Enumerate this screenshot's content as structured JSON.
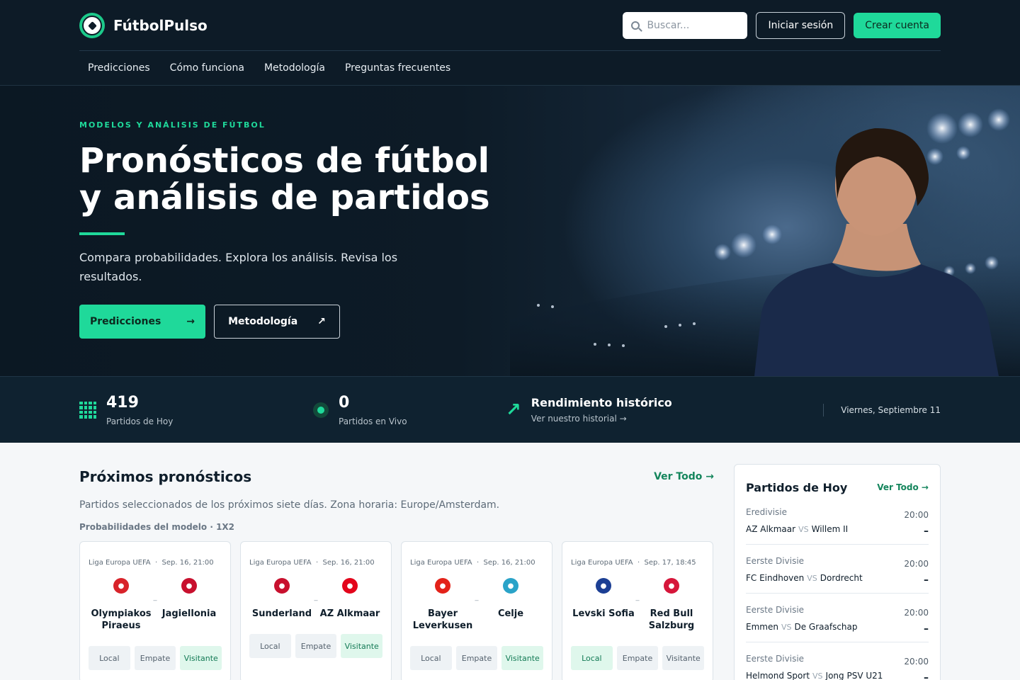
{
  "header": {
    "brand": "FútbolPulso",
    "search_placeholder": "Buscar...",
    "login": "Iniciar sesión",
    "signup": "Crear cuenta",
    "nav": [
      "Predicciones",
      "Cómo funciona",
      "Metodología",
      "Preguntas frecuentes"
    ]
  },
  "hero": {
    "eyebrow": "MODELOS Y ANÁLISIS DE FÚTBOL",
    "title_line1": "Pronósticos de fútbol",
    "title_line2": "y análisis de partidos",
    "subtitle": "Compara probabilidades. Explora los análisis. Revisa los resultados.",
    "cta_primary": "Predicciones",
    "cta_primary_icon": "→",
    "cta_secondary": "Metodología",
    "cta_secondary_icon": "↗"
  },
  "stats": {
    "today_count": "419",
    "today_label": "Partidos de Hoy",
    "live_count": "0",
    "live_label": "Partidos en Vivo",
    "perf_title": "Rendimiento histórico",
    "perf_link": "Ver nuestro historial →",
    "date": "Viernes, Septiembre 11"
  },
  "upcoming": {
    "title": "Próximos pronósticos",
    "view_all": "Ver Todo →",
    "description": "Partidos seleccionados de los próximos siete días. Zona horaria: Europe/Amsterdam.",
    "prob_label": "Probabilidades del modelo · 1X2",
    "option_labels": [
      "Local",
      "Empate",
      "Visitante"
    ],
    "cards": [
      {
        "competition": "Liga Europa UEFA",
        "date": "Sep. 16, 21:00",
        "home": "Olympiakos Piraeus",
        "away": "Jagiellonia",
        "home_color": "#d8232a",
        "away_color": "#c8102e",
        "highlight": 2
      },
      {
        "competition": "Liga Europa UEFA",
        "date": "Sep. 16, 21:00",
        "home": "Sunderland",
        "away": "AZ Alkmaar",
        "home_color": "#c8102e",
        "away_color": "#e3051b",
        "highlight": 2
      },
      {
        "competition": "Liga Europa UEFA",
        "date": "Sep. 16, 21:00",
        "home": "Bayer Leverkusen",
        "away": "Celje",
        "home_color": "#e32219",
        "away_color": "#2aa3c8",
        "highlight": 2
      },
      {
        "competition": "Liga Europa UEFA",
        "date": "Sep. 17, 18:45",
        "home": "Levski Sofia",
        "away": "Red Bull Salzburg",
        "home_color": "#1c3f94",
        "away_color": "#d6163a",
        "highlight": 0
      }
    ]
  },
  "today_panel": {
    "title": "Partidos de Hoy",
    "view_all": "Ver Todo →",
    "vs": "VS",
    "matches": [
      {
        "league": "Eredivisie",
        "home": "AZ Alkmaar",
        "away": "Willem II",
        "time": "20:00",
        "result": "–"
      },
      {
        "league": "Eerste Divisie",
        "home": "FC Eindhoven",
        "away": "Dordrecht",
        "time": "20:00",
        "result": "–"
      },
      {
        "league": "Eerste Divisie",
        "home": "Emmen",
        "away": "De Graafschap",
        "time": "20:00",
        "result": "–"
      },
      {
        "league": "Eerste Divisie",
        "home": "Helmond Sport",
        "away": "Jong PSV U21",
        "time": "20:00",
        "result": "–"
      }
    ]
  },
  "colors": {
    "accent": "#1fd99a",
    "dark": "#0d1b27",
    "link_green": "#14855c"
  }
}
